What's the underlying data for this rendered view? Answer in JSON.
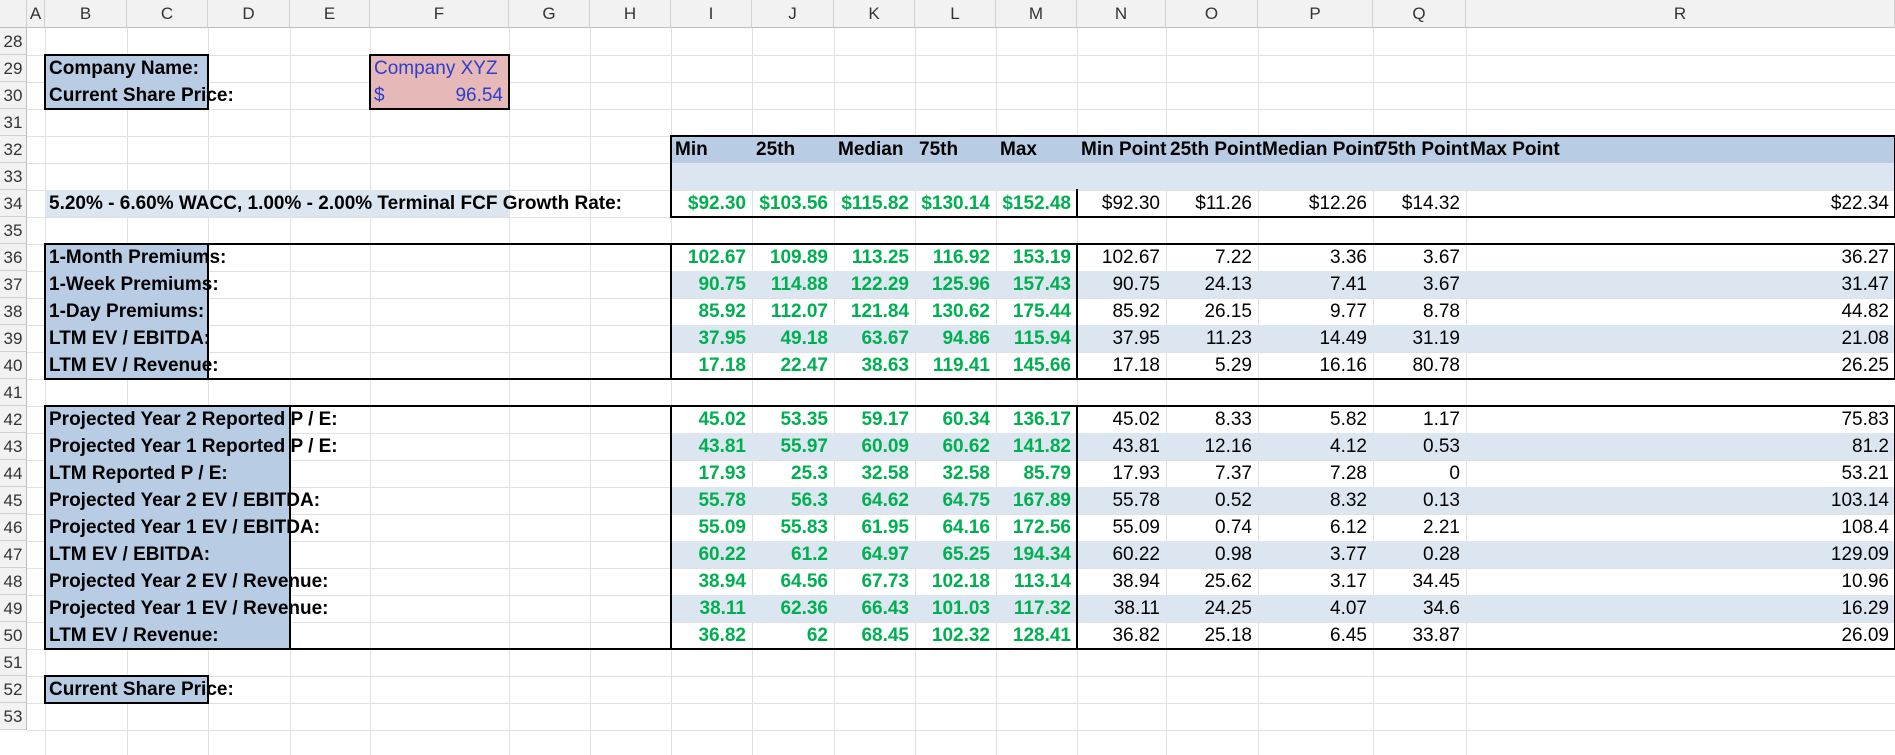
{
  "columns": [
    "A",
    "B",
    "C",
    "D",
    "E",
    "F",
    "G",
    "H",
    "I",
    "J",
    "K",
    "L",
    "M",
    "N",
    "O",
    "P",
    "Q",
    "R"
  ],
  "rows": [
    "28",
    "29",
    "30",
    "31",
    "32",
    "33",
    "34",
    "35",
    "36",
    "37",
    "38",
    "39",
    "40",
    "41",
    "42",
    "43",
    "44",
    "45",
    "46",
    "47",
    "48",
    "49",
    "50",
    "51",
    "52",
    "53"
  ],
  "company": {
    "name_label": "Company Name:",
    "name_value": "Company XYZ",
    "price_label": "Current Share Price:",
    "price_currency": "$",
    "price_value": "96.54"
  },
  "stat_headers": [
    "Min",
    "25th",
    "Median",
    "75th",
    "Max",
    "Min Point",
    "25th Point",
    "Median Point",
    "75th Point",
    "Max Point"
  ],
  "dcf_row": {
    "label": "5.20% - 6.60% WACC, 1.00% - 2.00% Terminal FCF Growth Rate:",
    "values": [
      "$92.30",
      "$103.56",
      "$115.82",
      "$130.14",
      "$152.48",
      "$92.30",
      "$11.26",
      "$12.26",
      "$14.32",
      "$22.34"
    ]
  },
  "premiums_section": [
    {
      "label": "1-Month Premiums:",
      "values": [
        "102.67",
        "109.89",
        "113.25",
        "116.92",
        "153.19",
        "102.67",
        "7.22",
        "3.36",
        "3.67",
        "36.27"
      ]
    },
    {
      "label": "1-Week Premiums:",
      "values": [
        "90.75",
        "114.88",
        "122.29",
        "125.96",
        "157.43",
        "90.75",
        "24.13",
        "7.41",
        "3.67",
        "31.47"
      ]
    },
    {
      "label": "1-Day Premiums:",
      "values": [
        "85.92",
        "112.07",
        "121.84",
        "130.62",
        "175.44",
        "85.92",
        "26.15",
        "9.77",
        "8.78",
        "44.82"
      ]
    },
    {
      "label": "LTM EV / EBITDA:",
      "values": [
        "37.95",
        "49.18",
        "63.67",
        "94.86",
        "115.94",
        "37.95",
        "11.23",
        "14.49",
        "31.19",
        "21.08"
      ]
    },
    {
      "label": "LTM EV / Revenue:",
      "values": [
        "17.18",
        "22.47",
        "38.63",
        "119.41",
        "145.66",
        "17.18",
        "5.29",
        "16.16",
        "80.78",
        "26.25"
      ]
    }
  ],
  "multiples_section": [
    {
      "label": "Projected Year 2 Reported P / E:",
      "values": [
        "45.02",
        "53.35",
        "59.17",
        "60.34",
        "136.17",
        "45.02",
        "8.33",
        "5.82",
        "1.17",
        "75.83"
      ]
    },
    {
      "label": "Projected Year 1 Reported P / E:",
      "values": [
        "43.81",
        "55.97",
        "60.09",
        "60.62",
        "141.82",
        "43.81",
        "12.16",
        "4.12",
        "0.53",
        "81.2"
      ]
    },
    {
      "label": "LTM Reported P / E:",
      "values": [
        "17.93",
        "25.3",
        "32.58",
        "32.58",
        "85.79",
        "17.93",
        "7.37",
        "7.28",
        "0",
        "53.21"
      ]
    },
    {
      "label": "Projected Year 2 EV / EBITDA:",
      "values": [
        "55.78",
        "56.3",
        "64.62",
        "64.75",
        "167.89",
        "55.78",
        "0.52",
        "8.32",
        "0.13",
        "103.14"
      ]
    },
    {
      "label": "Projected Year 1 EV / EBITDA:",
      "values": [
        "55.09",
        "55.83",
        "61.95",
        "64.16",
        "172.56",
        "55.09",
        "0.74",
        "6.12",
        "2.21",
        "108.4"
      ]
    },
    {
      "label": "LTM EV / EBITDA:",
      "values": [
        "60.22",
        "61.2",
        "64.97",
        "65.25",
        "194.34",
        "60.22",
        "0.98",
        "3.77",
        "0.28",
        "129.09"
      ]
    },
    {
      "label": "Projected Year 2 EV / Revenue:",
      "values": [
        "38.94",
        "64.56",
        "67.73",
        "102.18",
        "113.14",
        "38.94",
        "25.62",
        "3.17",
        "34.45",
        "10.96"
      ]
    },
    {
      "label": "Projected Year 1 EV / Revenue:",
      "values": [
        "38.11",
        "62.36",
        "66.43",
        "101.03",
        "117.32",
        "38.11",
        "24.25",
        "4.07",
        "34.6",
        "16.29"
      ]
    },
    {
      "label": "LTM EV / Revenue:",
      "values": [
        "36.82",
        "62",
        "68.45",
        "102.32",
        "128.41",
        "36.82",
        "25.18",
        "6.45",
        "33.87",
        "26.09"
      ]
    }
  ],
  "bottom_label": "Current Share Price:",
  "colors": {
    "label_fill": "#b8cce4",
    "band_fill": "#dce6f1",
    "input_fill": "#e6b8b7",
    "input_text": "#2e40c8",
    "green_text": "#00b050"
  }
}
